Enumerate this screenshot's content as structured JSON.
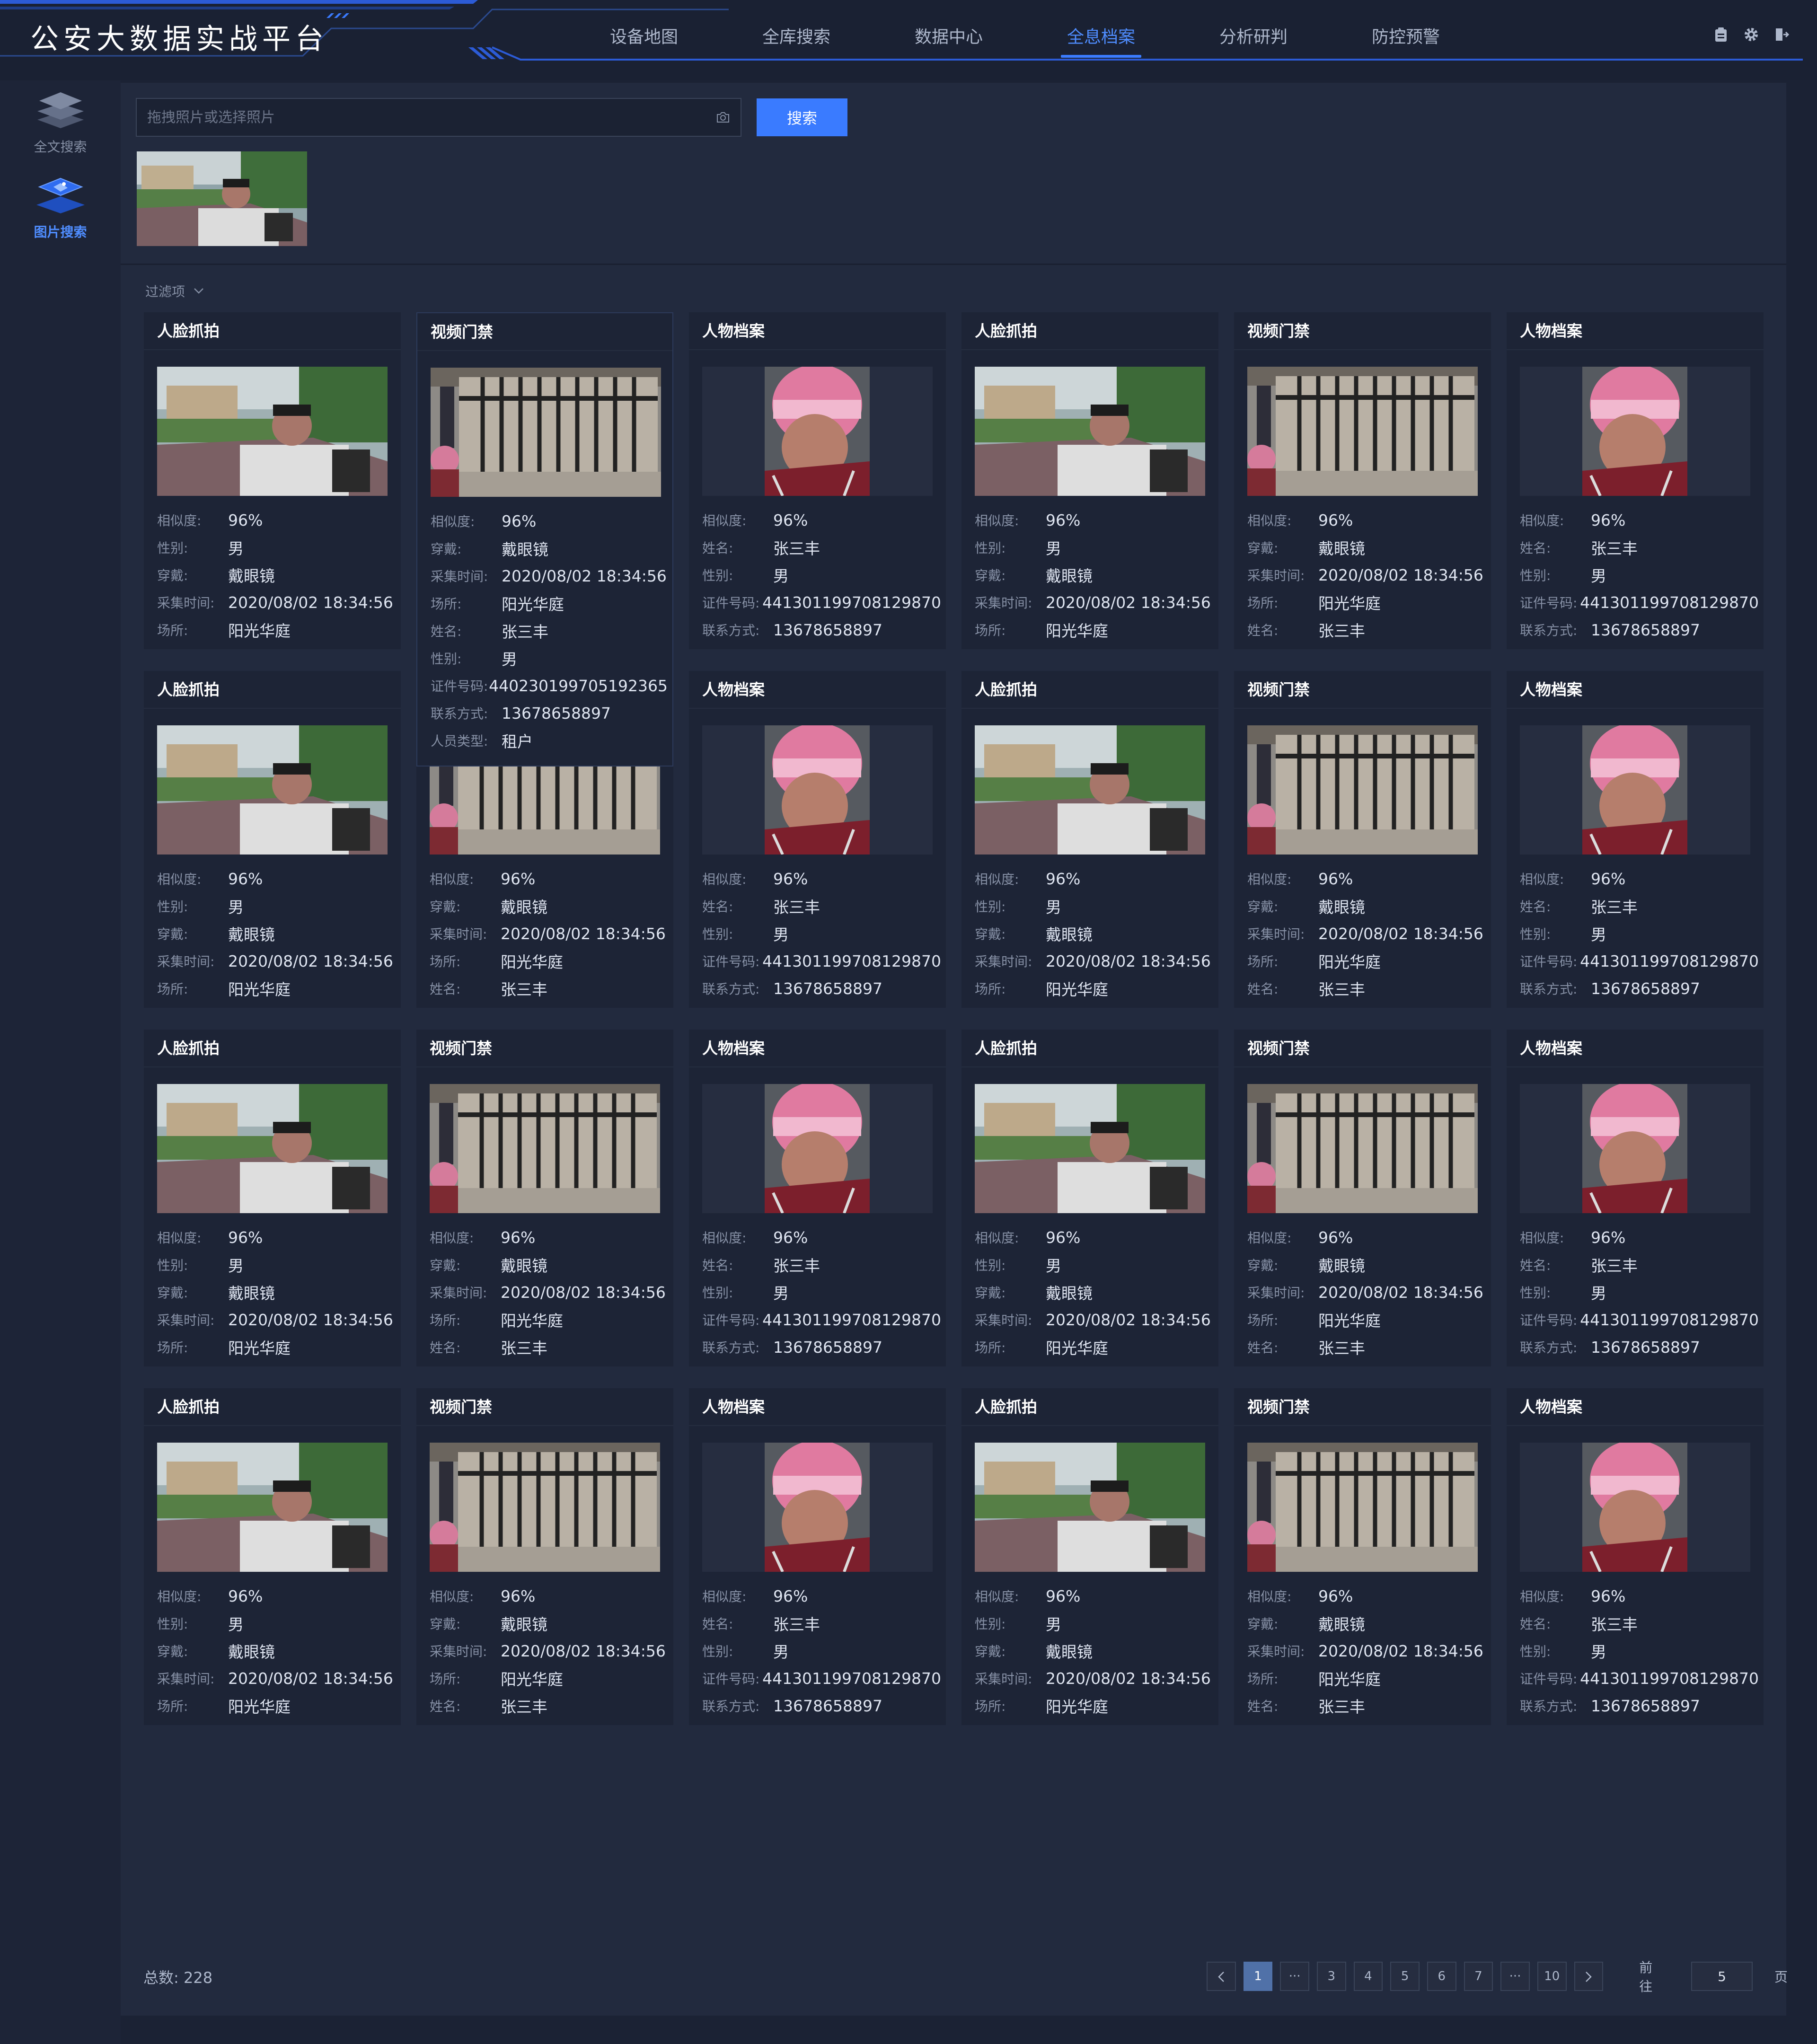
{
  "app": {
    "title": "公安大数据实战平台"
  },
  "nav": {
    "items": [
      "设备地图",
      "全库搜索",
      "数据中心",
      "全息档案",
      "分析研判",
      "防控预警"
    ],
    "active_index": 3
  },
  "header_icons": [
    "clipboard-icon",
    "gear-icon",
    "logout-icon"
  ],
  "sidebar": {
    "items": [
      {
        "label": "全文搜索",
        "icon": "layers-icon",
        "active": false
      },
      {
        "label": "图片搜索",
        "icon": "image-search-icon",
        "active": true
      }
    ]
  },
  "search": {
    "placeholder": "拖拽照片或选择照片",
    "value": "",
    "button_label": "搜索"
  },
  "filter": {
    "label": "过滤项"
  },
  "labels": {
    "similarity": "相似度:",
    "gender": "性别:",
    "wearing": "穿戴:",
    "capture_time": "采集时间:",
    "location": "场所:",
    "name": "姓名:",
    "id_number": "证件号码:",
    "contact": "联系方式:",
    "person_type": "人员类型:"
  },
  "card_types": {
    "face": "人脸抓拍",
    "gate": "视频门禁",
    "profile": "人物档案"
  },
  "card_values": {
    "similarity": "96%",
    "gender": "男",
    "wearing": "戴眼镜",
    "capture_time": "2020/08/02 18:34:56",
    "location": "阳光华庭",
    "name": "张三丰",
    "id_number": "441301199708129870",
    "contact": "13678658897"
  },
  "popup": {
    "similarity": "96%",
    "wearing": "戴眼镜",
    "capture_time": "2020/08/02 18:34:56",
    "location": "阳光华庭",
    "name": "张三丰",
    "gender": "男",
    "id_number": "440230199705192365",
    "contact": "13678658897",
    "person_type": "租户"
  },
  "footer": {
    "total_label": "总数:",
    "total_value": "228",
    "pages": [
      "1",
      "···",
      "3",
      "4",
      "5",
      "6",
      "7",
      "···",
      "10"
    ],
    "active_page": "1",
    "goto_label": "前往",
    "goto_value": "5",
    "page_suffix": "页"
  },
  "colors": {
    "accent": "#3a7bff",
    "background": "#1b2234",
    "panel": "#222a3e",
    "card": "#1d2436"
  }
}
